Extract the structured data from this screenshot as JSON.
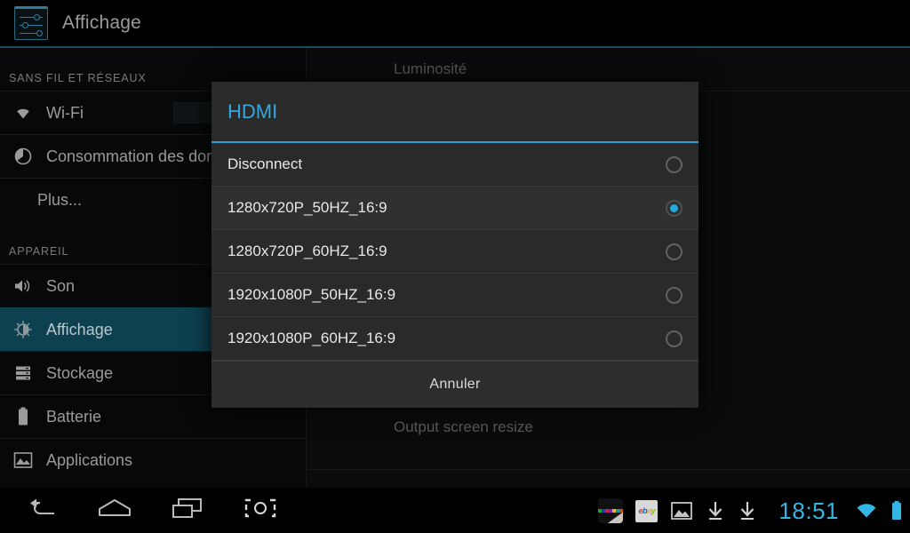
{
  "header": {
    "title": "Affichage",
    "icon": "display-settings-icon"
  },
  "sidebar": {
    "sections": [
      {
        "header": "SANS FIL ET RÉSEAUX",
        "items": [
          {
            "label": "Wi-Fi",
            "icon": "wifi-icon",
            "selected": false,
            "has_toggle": true
          },
          {
            "label": "Consommation des donn",
            "icon": "data-usage-icon",
            "selected": false,
            "has_toggle": false
          },
          {
            "label": "Plus...",
            "icon": "",
            "selected": false,
            "has_toggle": false
          }
        ]
      },
      {
        "header": "APPAREIL",
        "items": [
          {
            "label": "Son",
            "icon": "sound-icon",
            "selected": false,
            "has_toggle": false
          },
          {
            "label": "Affichage",
            "icon": "brightness-icon",
            "selected": true,
            "has_toggle": false
          },
          {
            "label": "Stockage",
            "icon": "storage-icon",
            "selected": false,
            "has_toggle": false
          },
          {
            "label": "Batterie",
            "icon": "battery-icon",
            "selected": false,
            "has_toggle": false
          },
          {
            "label": "Applications",
            "icon": "applications-icon",
            "selected": false,
            "has_toggle": false
          }
        ]
      }
    ]
  },
  "content": {
    "rows": [
      {
        "label": "Luminosité"
      },
      {
        "label": "Output screen resize"
      }
    ]
  },
  "dialog": {
    "title": "HDMI",
    "title_color": "#34a7dd",
    "accent_color": "#2a9fd4",
    "cancel_label": "Annuler",
    "options": [
      {
        "label": "Disconnect",
        "selected": false
      },
      {
        "label": "1280x720P_50HZ_16:9",
        "selected": true
      },
      {
        "label": "1280x720P_60HZ_16:9",
        "selected": false
      },
      {
        "label": "1920x1080P_50HZ_16:9",
        "selected": false
      },
      {
        "label": "1920x1080P_60HZ_16:9",
        "selected": false
      }
    ]
  },
  "navbar": {
    "buttons": [
      {
        "icon": "back-icon"
      },
      {
        "icon": "home-icon"
      },
      {
        "icon": "recents-icon"
      },
      {
        "icon": "screenshot-icon"
      }
    ],
    "status": {
      "notifications": [
        {
          "icon": "color-stripes-icon"
        },
        {
          "icon": "ebay-icon"
        },
        {
          "icon": "gallery-image-icon"
        },
        {
          "icon": "download-icon"
        },
        {
          "icon": "download-icon"
        }
      ],
      "clock": "18:51",
      "clock_color": "#33b5e5",
      "wifi": "wifi-signal-icon",
      "battery": "battery-full-icon"
    }
  }
}
